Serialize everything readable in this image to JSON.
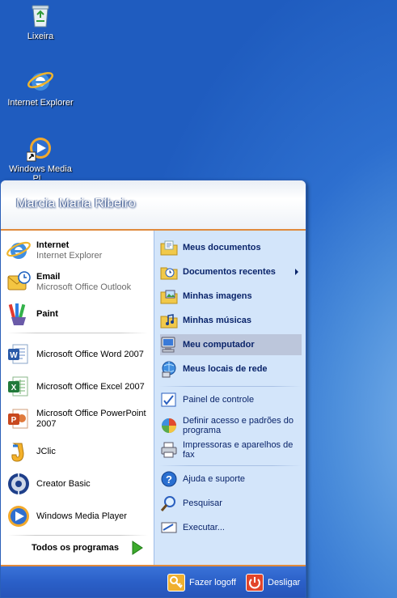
{
  "desktop": {
    "icons": [
      {
        "label": "Lixeira",
        "icon": "recycle-bin-icon"
      },
      {
        "label": "Internet Explorer",
        "icon": "internet-explorer-icon"
      },
      {
        "label": "Windows Media Pl...",
        "icon": "media-player-icon"
      }
    ]
  },
  "start_menu": {
    "user_name": "Marcia Maria Ribeiro",
    "pinned": [
      {
        "title": "Internet",
        "subtitle": "Internet Explorer",
        "icon": "internet-explorer-icon"
      },
      {
        "title": "Email",
        "subtitle": "Microsoft Office Outlook",
        "icon": "outlook-icon"
      },
      {
        "title": "Paint",
        "icon": "paint-icon"
      }
    ],
    "recent": [
      {
        "label": "Microsoft Office Word 2007",
        "icon": "word-icon"
      },
      {
        "label": "Microsoft Office Excel 2007",
        "icon": "excel-icon"
      },
      {
        "label": "Microsoft Office PowerPoint 2007",
        "icon": "powerpoint-icon"
      },
      {
        "label": "JClic",
        "icon": "jclic-icon"
      },
      {
        "label": "Creator Basic",
        "icon": "creator-basic-icon"
      },
      {
        "label": "Windows Media Player",
        "icon": "media-player-icon"
      }
    ],
    "all_programs": "Todos os programas",
    "places": [
      {
        "label": "Meus documentos",
        "icon": "my-documents-icon"
      },
      {
        "label": "Documentos recentes",
        "icon": "recent-documents-icon"
      },
      {
        "label": "Minhas imagens",
        "icon": "my-pictures-icon"
      },
      {
        "label": "Minhas músicas",
        "icon": "my-music-icon"
      },
      {
        "label": "Meu computador",
        "icon": "my-computer-icon"
      },
      {
        "label": "Meus locais de rede",
        "icon": "network-places-icon"
      }
    ],
    "settings": [
      {
        "label": "Painel de controle",
        "icon": "control-panel-icon"
      },
      {
        "label": "Definir acesso e padrões do programa",
        "icon": "program-defaults-icon"
      },
      {
        "label": "Impressoras e aparelhos de fax",
        "icon": "printers-icon"
      }
    ],
    "tools": [
      {
        "label": "Ajuda e suporte",
        "icon": "help-icon"
      },
      {
        "label": "Pesquisar",
        "icon": "search-icon"
      },
      {
        "label": "Executar...",
        "icon": "run-icon"
      }
    ],
    "footer": {
      "logoff": "Fazer logoff",
      "shutdown": "Desligar"
    }
  }
}
